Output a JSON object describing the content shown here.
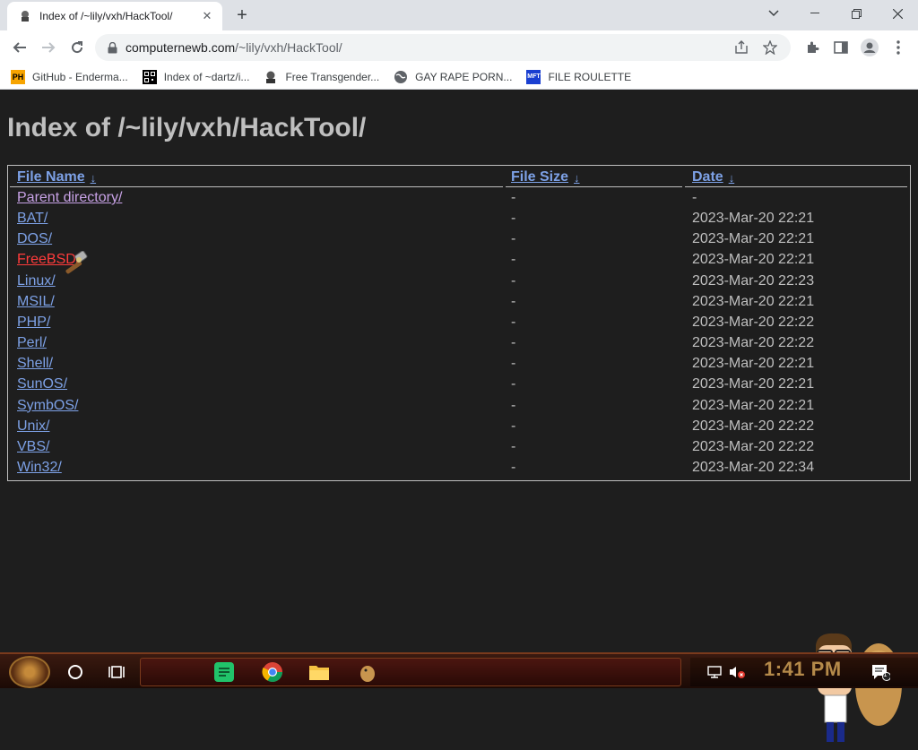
{
  "browser": {
    "tab_title": "Index of /~lily/vxh/HackTool/",
    "url_host": "computernewb.com",
    "url_path": "/~lily/vxh/HackTool/",
    "bookmarks": [
      {
        "label": "GitHub - Enderma...",
        "icon": "ph-logo-icon"
      },
      {
        "label": "Index of ~dartz/i...",
        "icon": "qr-icon"
      },
      {
        "label": "Free Transgender...",
        "icon": "globe-avatar-icon"
      },
      {
        "label": "GAY RAPE PORN...",
        "icon": "globe-icon"
      },
      {
        "label": "FILE ROULETTE",
        "icon": "mft-icon"
      }
    ]
  },
  "listing": {
    "heading": "Index of /~lily/vxh/HackTool/",
    "columns": {
      "name": "File Name",
      "size": "File Size",
      "date": "Date",
      "sort_arrow": "↓"
    },
    "rows": [
      {
        "name": "Parent directory/",
        "size": "-",
        "date": "-"
      },
      {
        "name": "BAT/",
        "size": "-",
        "date": "2023-Mar-20 22:21"
      },
      {
        "name": "DOS/",
        "size": "-",
        "date": "2023-Mar-20 22:21"
      },
      {
        "name": "FreeBSD/",
        "size": "-",
        "date": "2023-Mar-20 22:21"
      },
      {
        "name": "Linux/",
        "size": "-",
        "date": "2023-Mar-20 22:23"
      },
      {
        "name": "MSIL/",
        "size": "-",
        "date": "2023-Mar-20 22:21"
      },
      {
        "name": "PHP/",
        "size": "-",
        "date": "2023-Mar-20 22:22"
      },
      {
        "name": "Perl/",
        "size": "-",
        "date": "2023-Mar-20 22:22"
      },
      {
        "name": "Shell/",
        "size": "-",
        "date": "2023-Mar-20 22:21"
      },
      {
        "name": "SunOS/",
        "size": "-",
        "date": "2023-Mar-20 22:21"
      },
      {
        "name": "SymbOS/",
        "size": "-",
        "date": "2023-Mar-20 22:21"
      },
      {
        "name": "Unix/",
        "size": "-",
        "date": "2023-Mar-20 22:22"
      },
      {
        "name": "VBS/",
        "size": "-",
        "date": "2023-Mar-20 22:22"
      },
      {
        "name": "Win32/",
        "size": "-",
        "date": "2023-Mar-20 22:34"
      }
    ]
  },
  "taskbar": {
    "clock": "1:41 PM",
    "notification_count": "1"
  },
  "colors": {
    "link": "#7da1e6",
    "visited": "#c8a2e6",
    "hover": "#ff3b3b",
    "text": "#bfbfbf",
    "page_bg": "#1e1e1e"
  }
}
